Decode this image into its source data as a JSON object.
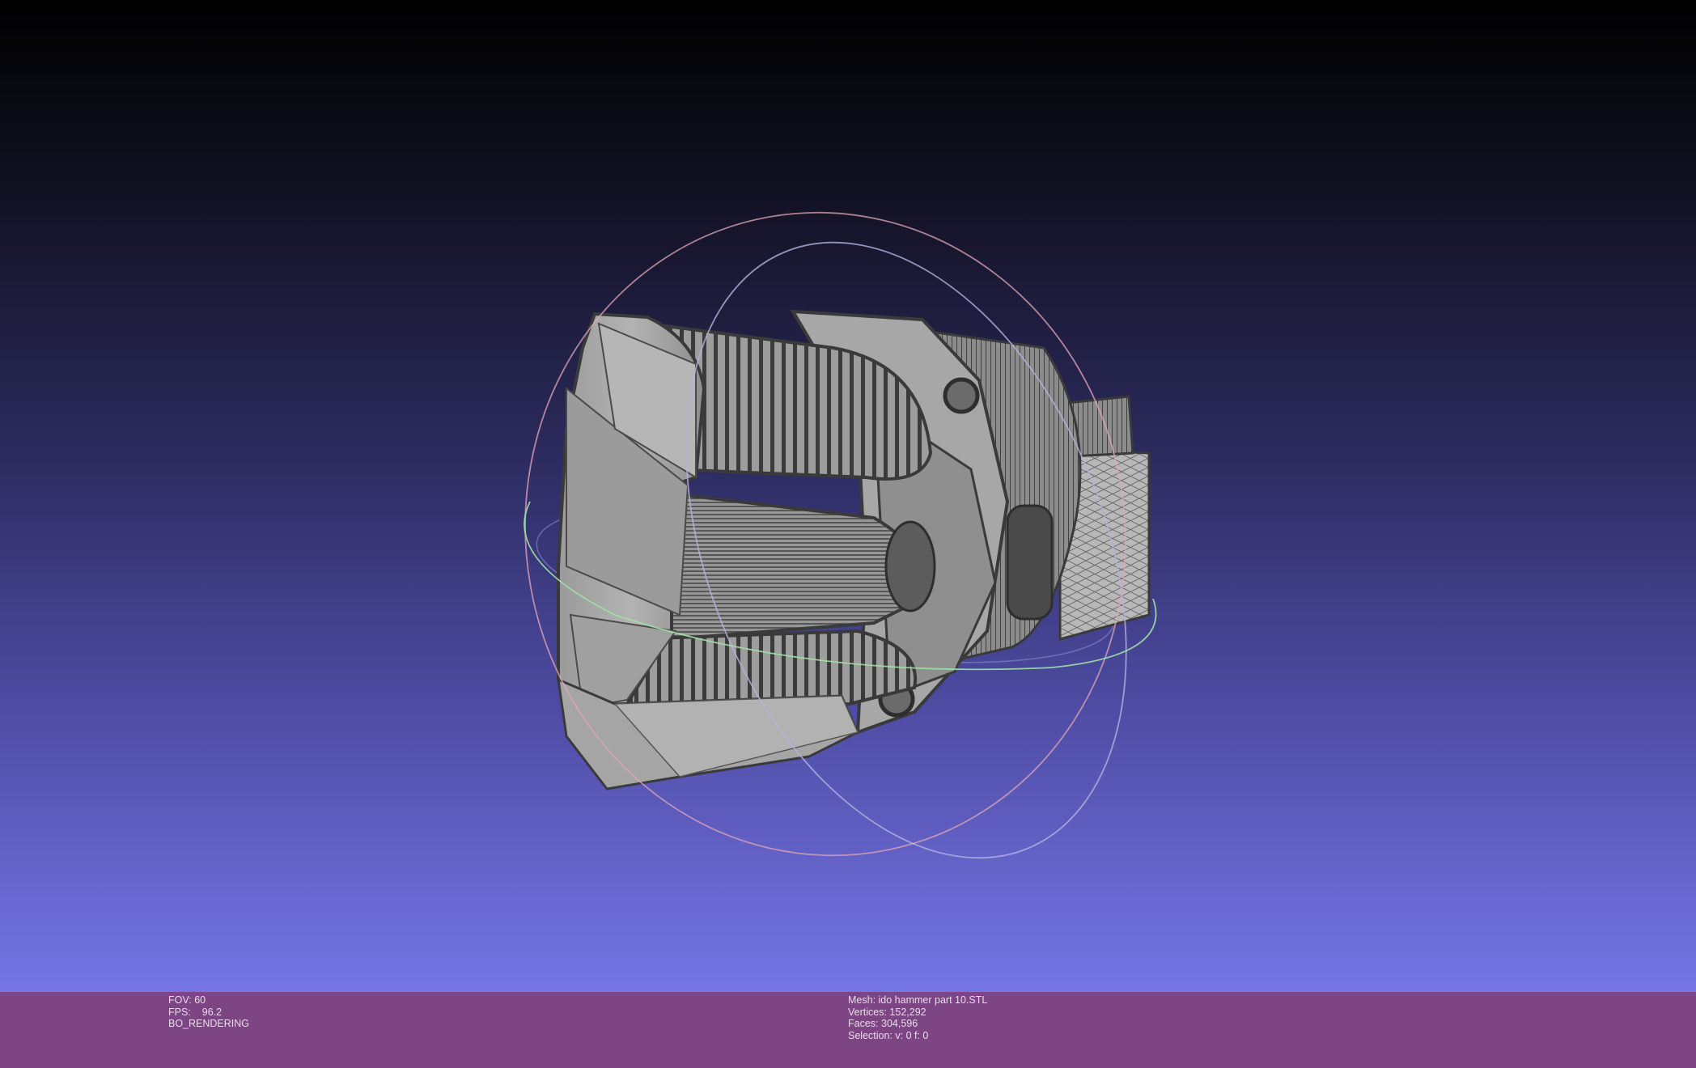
{
  "viewer": {
    "background_top": "#000000",
    "background_bottom": "#7575e6",
    "infobar_color": "#7e4585",
    "mesh_color": "#a8a8a8",
    "wire_color": "#3a3a3a",
    "trackball_colors": {
      "x_ring": "#e3a6b8",
      "y_ring": "#b6b2e0",
      "z_ring": "#9fe0a5"
    }
  },
  "status_left": {
    "fov_label": "FOV:",
    "fov_value": "60",
    "fps_label": "FPS:",
    "fps_value": "96.2",
    "render_mode": "BO_RENDERING"
  },
  "status_right": {
    "mesh_label": "Mesh:",
    "mesh_name": "ido hammer part 10.STL",
    "vertices_label": "Vertices:",
    "vertices_value": "152,292",
    "faces_label": "Faces:",
    "faces_value": "304,596",
    "selection_label": "Selection:",
    "selection_value": "v: 0 f: 0"
  }
}
